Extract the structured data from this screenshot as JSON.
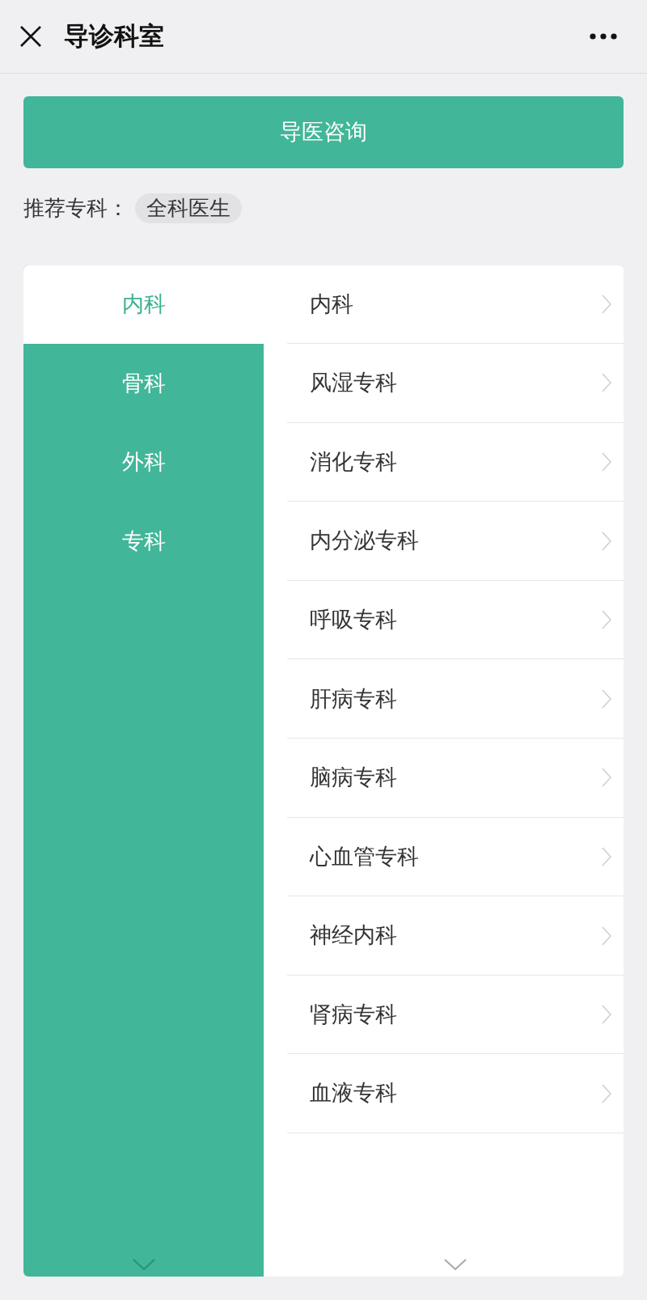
{
  "header": {
    "title": "导诊科室"
  },
  "consult_button": {
    "label": "导医咨询"
  },
  "recommended": {
    "label": "推荐专科：",
    "tags": [
      "全科医生"
    ]
  },
  "categories": [
    {
      "label": "内科",
      "selected": true
    },
    {
      "label": "骨科",
      "selected": false
    },
    {
      "label": "外科",
      "selected": false
    },
    {
      "label": "专科",
      "selected": false
    }
  ],
  "departments": [
    "内科",
    "风湿专科",
    "消化专科",
    "内分泌专科",
    "呼吸专科",
    "肝病专科",
    "脑病专科",
    "心血管专科",
    "神经内科",
    "肾病专科",
    "血液专科"
  ]
}
